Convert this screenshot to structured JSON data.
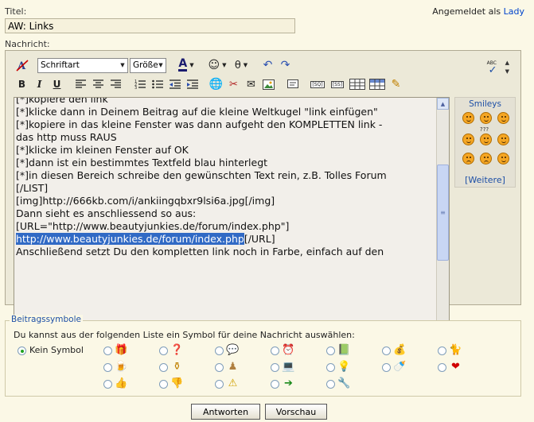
{
  "header": {
    "title_label": "Titel:",
    "login_prefix": "Angemeldet als",
    "login_user": "Lady"
  },
  "title_input": {
    "value": "AW: Links"
  },
  "message_label": "Nachricht:",
  "toolbar": {
    "font_select": "Schriftart",
    "size_select": "Größe",
    "bold": "B",
    "italic": "I",
    "underline": "U",
    "font_color_letter": "A",
    "spell_label": "ABC",
    "list_tag": "[SQ]",
    "list_tag2": "[SS]"
  },
  "message": {
    "lines": [
      "[*]kopiere den link",
      "[*]klicke dann in Deinem Beitrag auf die kleine Weltkugel \"link einfügen\"",
      "[*]kopiere in das kleine Fenster was dann aufgeht den KOMPLETTEN link -",
      "das http muss RAUS",
      "[*]klicke im kleinen Fenster auf OK",
      "[*]dann ist ein bestimmtes Textfeld blau hinterlegt",
      "[*]in diesen Bereich schreibe den gewünschten Text rein, z.B. Tolles Forum",
      "[/LIST]",
      "",
      "[img]http://666kb.com/i/ankiingqbxr9lsi6a.jpg[/img]",
      "",
      "Dann sieht es anschliessend so aus:",
      "",
      "[URL=\"http://www.beautyjunkies.de/forum/index.php\"]"
    ],
    "highlight_line": "http://www.beautyjunkies.de/forum/index.php",
    "highlight_tail": "[/URL]",
    "after_lines": [
      "",
      "Anschließend setzt Du den kompletten link noch in Farbe, einfach auf den"
    ]
  },
  "smileys": {
    "title": "Smileys",
    "more_link": "[Weitere]",
    "question_marks": "???"
  },
  "symbols": {
    "legend": "Beitragssymbole",
    "description": "Du kannst aus der folgenden Liste ein Symbol für deine Nachricht auswählen:",
    "none_label": "Kein Symbol",
    "row1": [
      "gift-icon",
      "question-box-icon",
      "speech-bubble-icon",
      "alarm-clock-icon",
      "book-icon",
      "money-bag-icon",
      "cat-icon"
    ],
    "row2": [
      "beer-icon",
      "perfume-icon",
      "pawn-icon",
      "laptop-icon",
      "lightbulb-icon",
      "pacifier-icon",
      "heart-icon"
    ],
    "row3": [
      "thumbs-up-icon",
      "thumbs-down-icon",
      "warning-icon",
      "arrow-right-icon",
      "tools-icon"
    ]
  },
  "buttons": {
    "submit": "Antworten",
    "preview": "Vorschau"
  }
}
